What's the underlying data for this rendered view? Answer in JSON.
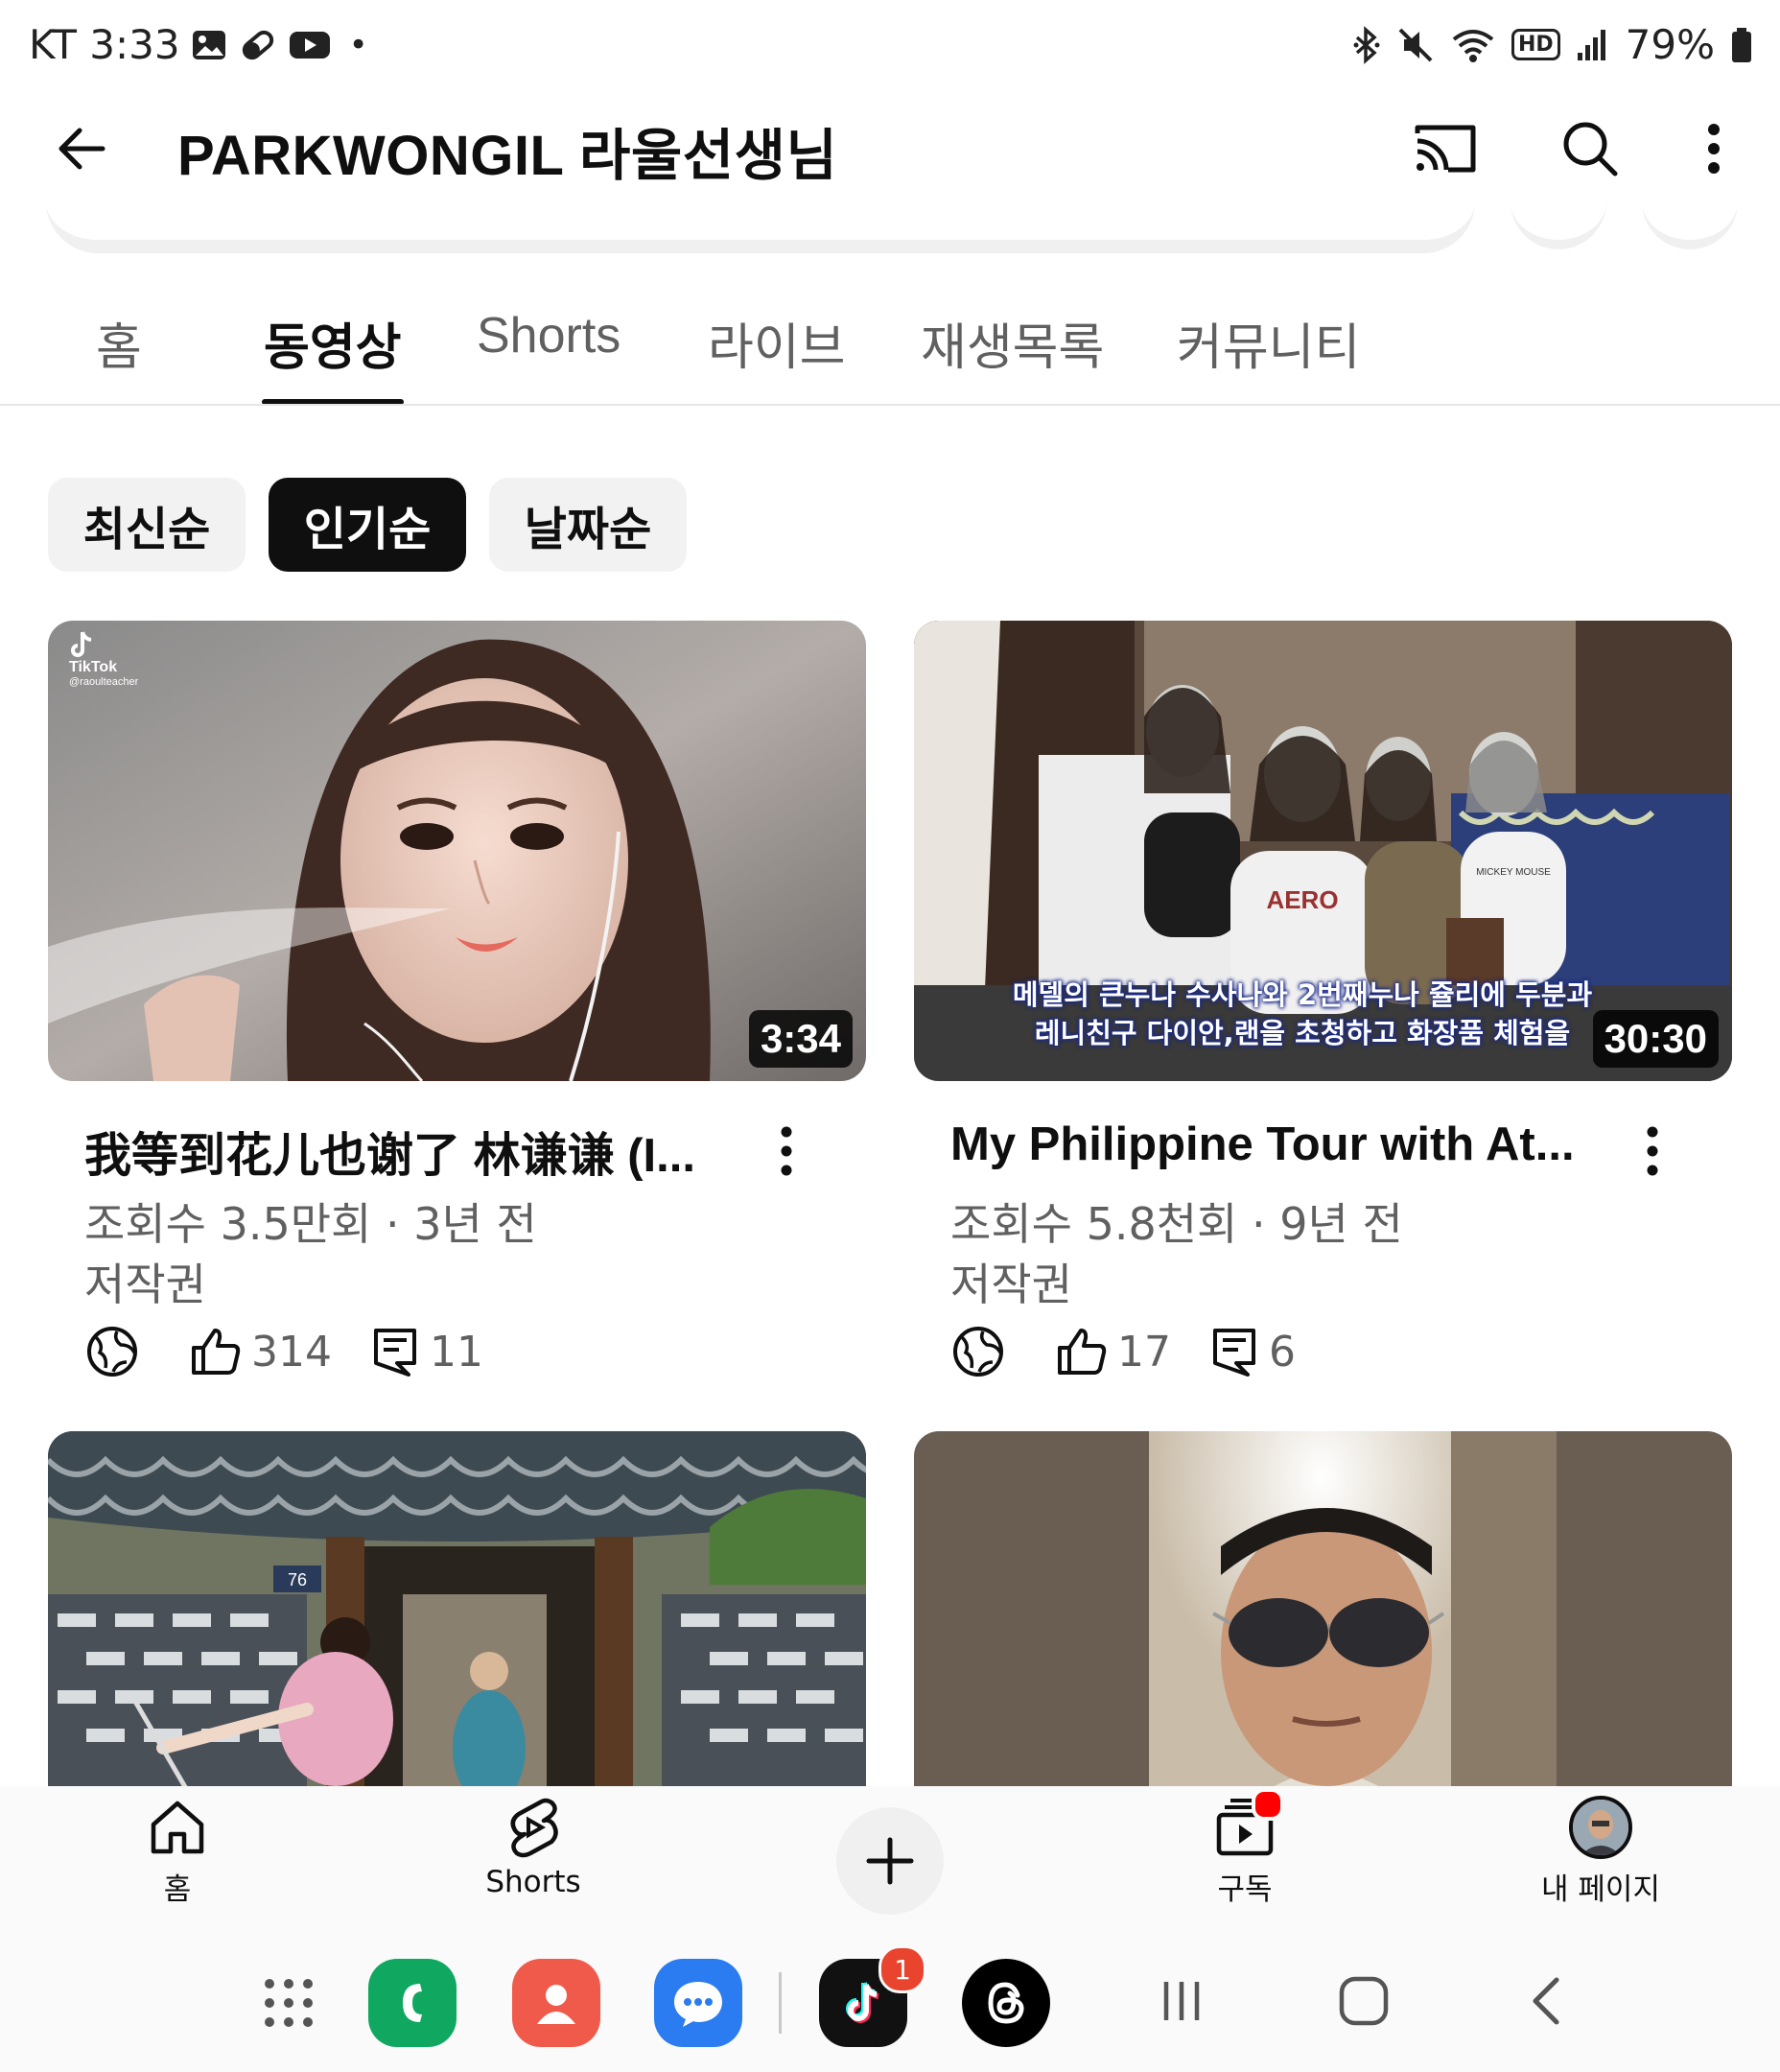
{
  "status_bar": {
    "carrier_time": "KT 3:33",
    "battery": "79%",
    "hd_badge": "HD"
  },
  "header": {
    "title": "PARKWONGIL 라울선생님",
    "back_icon": "back-arrow-icon",
    "cast_icon": "cast-icon",
    "search_icon": "search-icon",
    "more_icon": "more-vert-icon"
  },
  "tabs": [
    {
      "label": "홈",
      "active": false
    },
    {
      "label": "동영상",
      "active": true
    },
    {
      "label": "Shorts",
      "active": false
    },
    {
      "label": "라이브",
      "active": false
    },
    {
      "label": "재생목록",
      "active": false
    },
    {
      "label": "커뮤니티",
      "active": false
    }
  ],
  "sort_chips": [
    {
      "label": "최신순",
      "selected": false
    },
    {
      "label": "인기순",
      "selected": true
    },
    {
      "label": "날짜순",
      "selected": false
    }
  ],
  "videos": [
    {
      "title": "我等到花儿也谢了 林谦谦 (I...",
      "meta": "조회수 3.5만회 · 3년 전",
      "license": "저작권",
      "duration": "3:34",
      "likes": "314",
      "comments": "11",
      "thumb_watermark": "TikTok",
      "thumb_handle": "@raoulteacher"
    },
    {
      "title": "My Philippine Tour with At...",
      "meta": "조회수 5.8천회 · 9년 전",
      "license": "저작권",
      "duration": "30:30",
      "likes": "17",
      "comments": "6",
      "subtitle_line1": "메델의 큰누나 수사나와 2번째누나 쥴리에 두분과",
      "subtitle_line2": "레니친구 다이안,랜을 초청하고 화장품 체험을",
      "shirt_text": "AERO",
      "shirt_text2": "MICKEY MOUSE"
    },
    {
      "sign_number": "76"
    },
    {}
  ],
  "bottom_nav": [
    {
      "label": "홈",
      "icon": "home-icon"
    },
    {
      "label": "Shorts",
      "icon": "shorts-icon"
    },
    {
      "label": "",
      "icon": "create-plus-icon"
    },
    {
      "label": "구독",
      "icon": "subscriptions-icon"
    },
    {
      "label": "내 페이지",
      "icon": "avatar"
    }
  ],
  "dock": {
    "tiktok_badge": "1"
  },
  "colors": {
    "accent": "#0f0f0f",
    "secondary_text": "#606060",
    "chip_bg": "#f2f2f2",
    "notification_red": "#ff0000"
  }
}
